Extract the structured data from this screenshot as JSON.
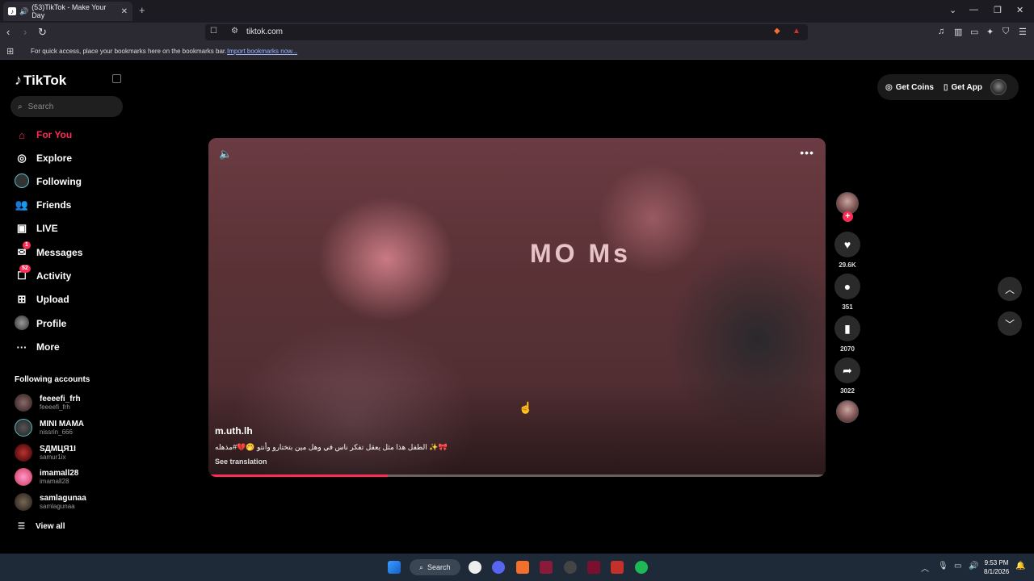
{
  "browser": {
    "tab_title": "(53)TikTok - Make Your Day",
    "url": "tiktok.com",
    "bookmarks_message": "For quick access, place your bookmarks here on the bookmarks bar.",
    "bookmarks_link": "Import bookmarks now..."
  },
  "sidebar": {
    "logo": "TikTok",
    "search_placeholder": "Search",
    "nav": [
      {
        "label": "For You",
        "icon": "home-icon",
        "active": true
      },
      {
        "label": "Explore",
        "icon": "compass-icon"
      },
      {
        "label": "Following",
        "icon": "following-avatar-icon"
      },
      {
        "label": "Friends",
        "icon": "friends-icon"
      },
      {
        "label": "LIVE",
        "icon": "live-icon"
      },
      {
        "label": "Messages",
        "icon": "messages-icon",
        "badge": "1"
      },
      {
        "label": "Activity",
        "icon": "activity-icon",
        "badge": "52"
      },
      {
        "label": "Upload",
        "icon": "upload-icon"
      },
      {
        "label": "Profile",
        "icon": "profile-icon"
      },
      {
        "label": "More",
        "icon": "more-icon"
      }
    ],
    "following_heading": "Following accounts",
    "accounts": [
      {
        "name": "feeeefi_frh",
        "handle": "feeeefi_frh"
      },
      {
        "name": "MINI MAMA",
        "handle": "nissrin_666"
      },
      {
        "name": "SДМЦЯ1I",
        "handle": "samur1ix"
      },
      {
        "name": "imamall28",
        "handle": "imamall28"
      },
      {
        "name": "samlagunaa",
        "handle": "samlagunaa"
      }
    ],
    "view_all": "View all"
  },
  "header": {
    "get_coins": "Get Coins",
    "get_app": "Get App"
  },
  "video": {
    "author": "m.uth.lh",
    "caption": "الطفل هذا  مثل يعقل تفكر ناس في وهل مين بتختارو وأنتو 🤭💔#مذهله ✨🎀",
    "see_translation": "See translation",
    "progress": 0.29
  },
  "actions": {
    "likes": "29.6K",
    "comments": "351",
    "saves": "2070",
    "shares": "3022"
  },
  "taskbar": {
    "search_label": "Search",
    "time": "9:53 PM",
    "date": "8/1/2026"
  },
  "colors": {
    "accent": "#fe2c55",
    "background": "#000000"
  }
}
